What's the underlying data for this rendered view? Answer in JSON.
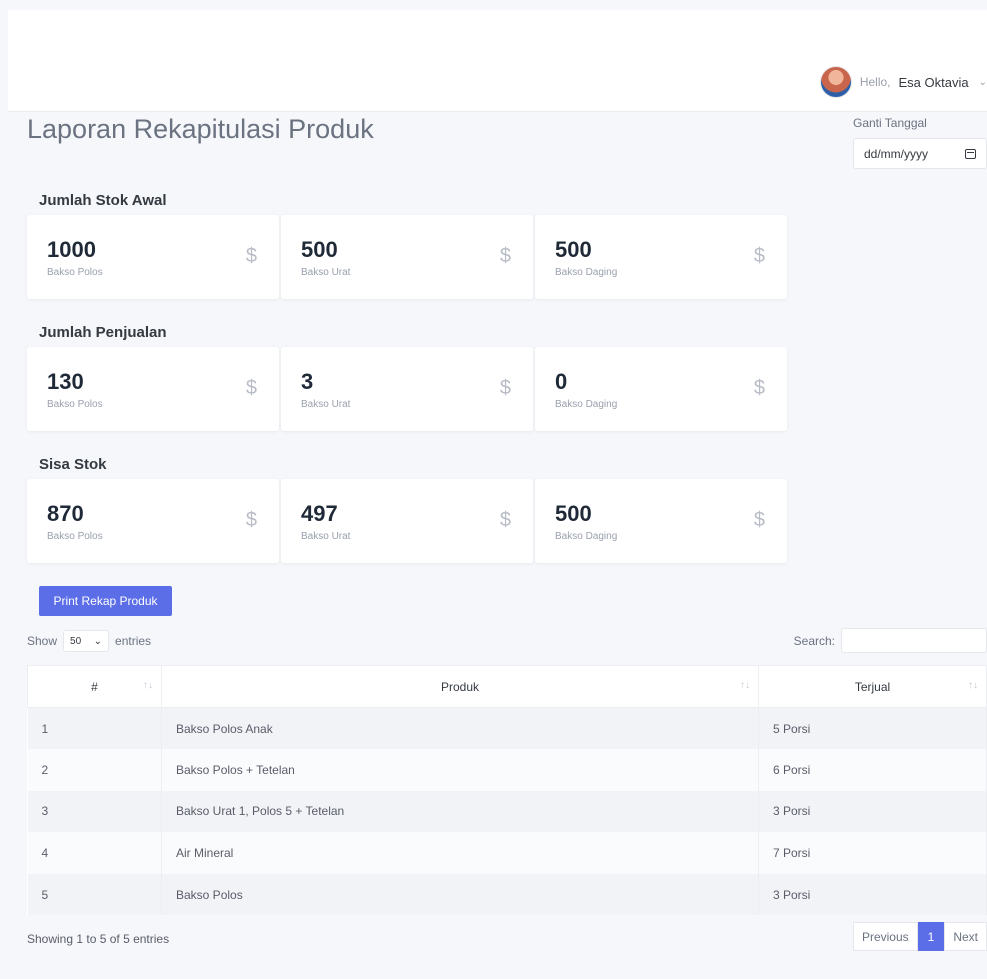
{
  "header": {
    "greeting": "Hello,",
    "user_name": "Esa Oktavia",
    "chevron_icon": "chevron-down-icon"
  },
  "page": {
    "title": "Laporan Rekapitulasi Produk",
    "date_label": "Ganti Tanggal",
    "date_placeholder": "dd/mm/yyyy"
  },
  "sections": [
    {
      "title": "Jumlah Stok Awal",
      "cards": [
        {
          "value": "1000",
          "label": "Bakso Polos",
          "icon": "$"
        },
        {
          "value": "500",
          "label": "Bakso Urat",
          "icon": "$"
        },
        {
          "value": "500",
          "label": "Bakso Daging",
          "icon": "$"
        }
      ]
    },
    {
      "title": "Jumlah Penjualan",
      "cards": [
        {
          "value": "130",
          "label": "Bakso Polos",
          "icon": "$"
        },
        {
          "value": "3",
          "label": "Bakso Urat",
          "icon": "$"
        },
        {
          "value": "0",
          "label": "Bakso Daging",
          "icon": "$"
        }
      ]
    },
    {
      "title": "Sisa Stok",
      "cards": [
        {
          "value": "870",
          "label": "Bakso Polos",
          "icon": "$"
        },
        {
          "value": "497",
          "label": "Bakso Urat",
          "icon": "$"
        },
        {
          "value": "500",
          "label": "Bakso Daging",
          "icon": "$"
        }
      ]
    }
  ],
  "actions": {
    "print_label": "Print Rekap Produk"
  },
  "table_controls": {
    "show_label": "Show",
    "entries_value": "50",
    "entries_label": "entries",
    "search_label": "Search:"
  },
  "table": {
    "columns": [
      "#",
      "Produk",
      "Terjual"
    ],
    "rows": [
      [
        "1",
        "Bakso Polos Anak",
        "5 Porsi"
      ],
      [
        "2",
        "Bakso Polos + Tetelan",
        "6 Porsi"
      ],
      [
        "3",
        "Bakso Urat 1, Polos 5 + Tetelan",
        "3 Porsi"
      ],
      [
        "4",
        "Air Mineral",
        "7 Porsi"
      ],
      [
        "5",
        "Bakso Polos",
        "3 Porsi"
      ]
    ]
  },
  "footer": {
    "info": "Showing 1 to 5 of 5 entries",
    "previous": "Previous",
    "page": "1",
    "next": "Next"
  },
  "colors": {
    "accent": "#5b6ee8",
    "background": "#f5f7fb"
  }
}
